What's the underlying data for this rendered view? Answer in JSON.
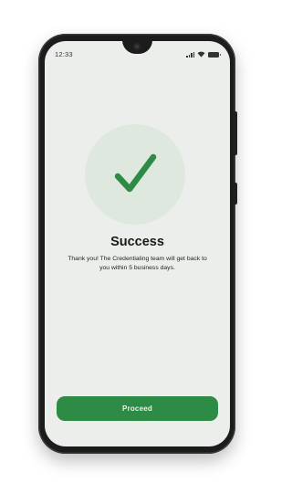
{
  "status_bar": {
    "time": "12:33"
  },
  "success": {
    "title": "Success",
    "message": "Thank you! The Credentialing team will get back to you within 5 business days."
  },
  "actions": {
    "proceed_label": "Proceed"
  },
  "colors": {
    "accent": "#2e8b45",
    "check_circle_bg": "#dfe8df",
    "screen_bg": "#eceeec"
  }
}
